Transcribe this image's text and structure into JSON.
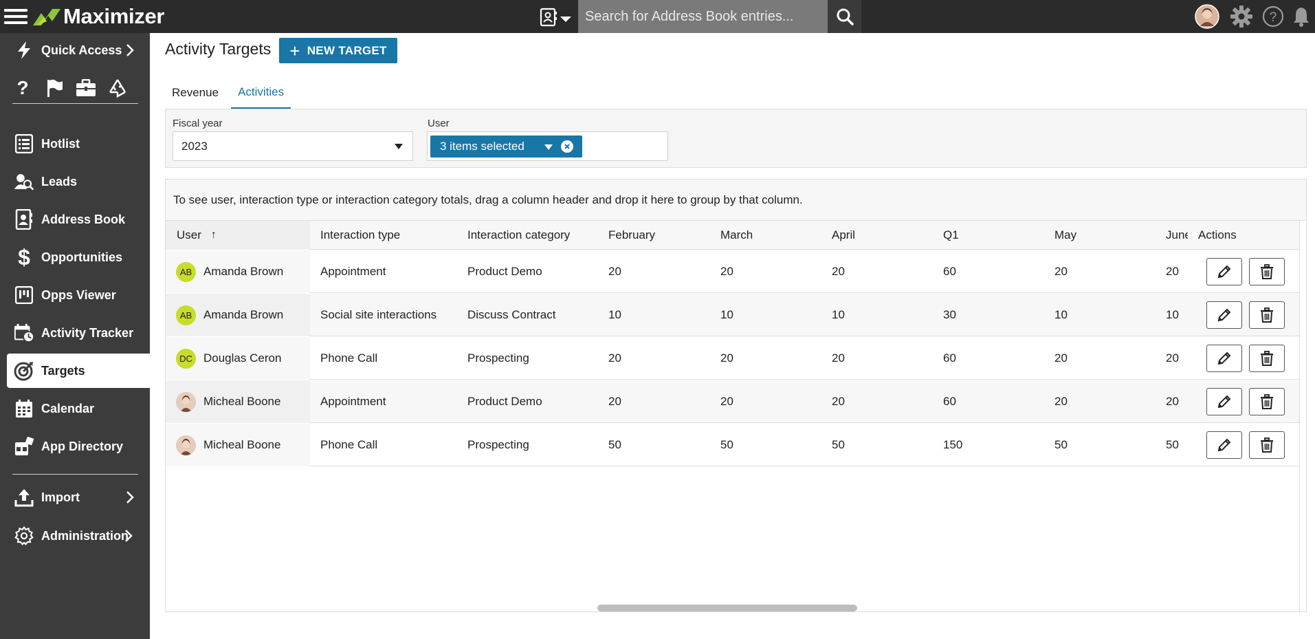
{
  "app": {
    "name": "Maximizer"
  },
  "search": {
    "placeholder": "Search for Address Book entries..."
  },
  "sidebar": {
    "quick_access": "Quick Access",
    "quick_icons": [
      "help-icon",
      "flag-icon",
      "briefcase-icon",
      "recycle-icon"
    ],
    "items": [
      {
        "label": "Hotlist",
        "icon": "hotlist-icon"
      },
      {
        "label": "Leads",
        "icon": "leads-icon"
      },
      {
        "label": "Address Book",
        "icon": "address-book-icon"
      },
      {
        "label": "Opportunities",
        "icon": "dollar-icon"
      },
      {
        "label": "Opps Viewer",
        "icon": "opps-viewer-icon"
      },
      {
        "label": "Activity Tracker",
        "icon": "calendar-clock-icon"
      },
      {
        "label": "Targets",
        "icon": "target-icon",
        "active": true
      },
      {
        "label": "Calendar",
        "icon": "calendar-icon"
      },
      {
        "label": "App Directory",
        "icon": "app-directory-icon"
      }
    ],
    "import": "Import",
    "administration": "Administration"
  },
  "page": {
    "title": "Activity Targets",
    "new_target": "NEW TARGET",
    "tabs": [
      {
        "label": "Revenue",
        "active": false
      },
      {
        "label": "Activities",
        "active": true
      }
    ]
  },
  "filters": {
    "fiscal_year_label": "Fiscal year",
    "fiscal_year_value": "2023",
    "user_label": "User",
    "user_value": "3 items selected"
  },
  "grid": {
    "group_hint": "To see user, interaction type or interaction category totals, drag a column header and drop it here to group by that column.",
    "columns": {
      "user": "User",
      "interaction_type": "Interaction type",
      "interaction_category": "Interaction category",
      "february": "February",
      "march": "March",
      "april": "April",
      "q1": "Q1",
      "may": "May",
      "june": "June",
      "actions": "Actions"
    },
    "rows": [
      {
        "initials": "AB",
        "user": "Amanda Brown",
        "interaction_type": "Appointment",
        "interaction_category": "Product Demo",
        "february": "20",
        "march": "20",
        "april": "20",
        "q1": "60",
        "may": "20",
        "june": "20"
      },
      {
        "initials": "AB",
        "user": "Amanda Brown",
        "interaction_type": "Social site interactions",
        "interaction_category": "Discuss Contract",
        "february": "10",
        "march": "10",
        "april": "10",
        "q1": "30",
        "may": "10",
        "june": "10"
      },
      {
        "initials": "DC",
        "user": "Douglas Ceron",
        "interaction_type": "Phone Call",
        "interaction_category": "Prospecting",
        "february": "20",
        "march": "20",
        "april": "20",
        "q1": "60",
        "may": "20",
        "june": "20"
      },
      {
        "initials": "",
        "user": "Micheal Boone",
        "interaction_type": "Appointment",
        "interaction_category": "Product Demo",
        "february": "20",
        "march": "20",
        "april": "20",
        "q1": "60",
        "may": "20",
        "june": "20"
      },
      {
        "initials": "",
        "user": "Micheal Boone",
        "interaction_type": "Phone Call",
        "interaction_category": "Prospecting",
        "february": "50",
        "march": "50",
        "april": "50",
        "q1": "150",
        "may": "50",
        "june": "50"
      }
    ]
  },
  "colors": {
    "accent": "#1877a6",
    "sidebar_bg": "#3c3c3c",
    "topbar_bg": "#2b2b2b",
    "avatar_initials_bg": "#c8dc2a"
  }
}
